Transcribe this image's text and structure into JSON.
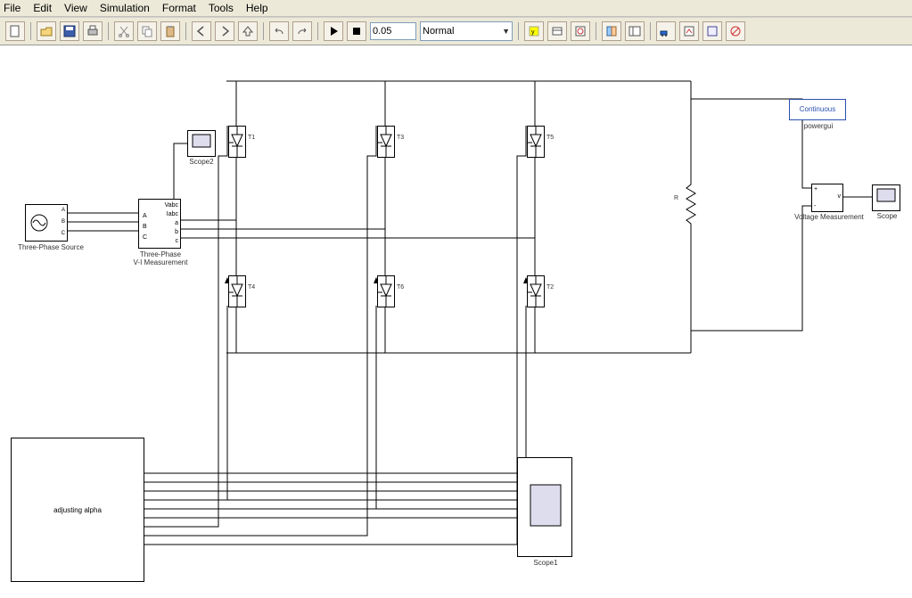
{
  "menu": {
    "items": [
      "File",
      "Edit",
      "View",
      "Simulation",
      "Format",
      "Tools",
      "Help"
    ]
  },
  "toolbar": {
    "sim_time": "0.05",
    "mode": "Normal"
  },
  "blocks": {
    "source": {
      "label": "Three-Phase Source",
      "ports": [
        "A",
        "B",
        "C"
      ]
    },
    "vi": {
      "label": "Three-Phase\nV-I Measurement",
      "top": "Vabc",
      "mid": "Iabc",
      "pA": "A",
      "pB": "B",
      "pC": "C",
      "oa": "a",
      "ob": "b",
      "oc": "c"
    },
    "scope2": {
      "label": "Scope2"
    },
    "scope1": {
      "label": "Scope1"
    },
    "scope": {
      "label": "Scope"
    },
    "vm": {
      "label": "Voltage Measurement",
      "plus": "+",
      "minus": "-",
      "out": "v"
    },
    "r": {
      "label": "R"
    },
    "powergui": {
      "label": "powergui",
      "text": "Continuous"
    },
    "alpha": {
      "label": "adjusting alpha"
    },
    "thy": {
      "t1": "T1",
      "t3": "T3",
      "t5": "T5",
      "t4": "T4",
      "t6": "T6",
      "t2": "T2"
    }
  }
}
